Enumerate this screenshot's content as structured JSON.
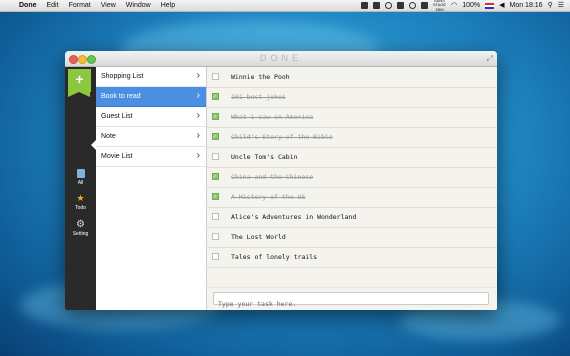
{
  "menubar": {
    "app_name": "Done",
    "items": [
      "Edit",
      "Format",
      "View",
      "Window",
      "Help"
    ],
    "battery": "100%",
    "clock": "Mon 18:16",
    "status_small": "SANS\nSTAGE\n1BM"
  },
  "window": {
    "title": "DONE"
  },
  "sidebar": {
    "add_label": "+",
    "nav": [
      {
        "label": "All",
        "icon": "notebook-icon"
      },
      {
        "label": "Todo",
        "icon": "star-icon"
      },
      {
        "label": "Setting",
        "icon": "gear-icon"
      }
    ]
  },
  "lists": {
    "selected_index": 1,
    "items": [
      {
        "label": "Shopping List"
      },
      {
        "label": "Book to read"
      },
      {
        "label": "Guest List"
      },
      {
        "label": "Note"
      },
      {
        "label": "Movie List"
      }
    ]
  },
  "tasks": [
    {
      "text": "Winnie the Pooh",
      "done": false
    },
    {
      "text": "101 best jokes",
      "done": true
    },
    {
      "text": "What i saw in America",
      "done": true
    },
    {
      "text": "Child's Story of the Bible",
      "done": true
    },
    {
      "text": "Uncle Tom's Cabin",
      "done": false
    },
    {
      "text": "China and the Chinese",
      "done": true
    },
    {
      "text": "A History of the US",
      "done": true
    },
    {
      "text": "Alice's Adventures in Wonderland",
      "done": false
    },
    {
      "text": "The Lost World",
      "done": false
    },
    {
      "text": "Tales of lonely trails",
      "done": false
    }
  ],
  "task_input": {
    "placeholder": "Type your task here.",
    "value": ""
  },
  "colors": {
    "accent_green": "#8dc63f",
    "selection_blue": "#4a8fe1",
    "check_green": "#8cc66f"
  }
}
